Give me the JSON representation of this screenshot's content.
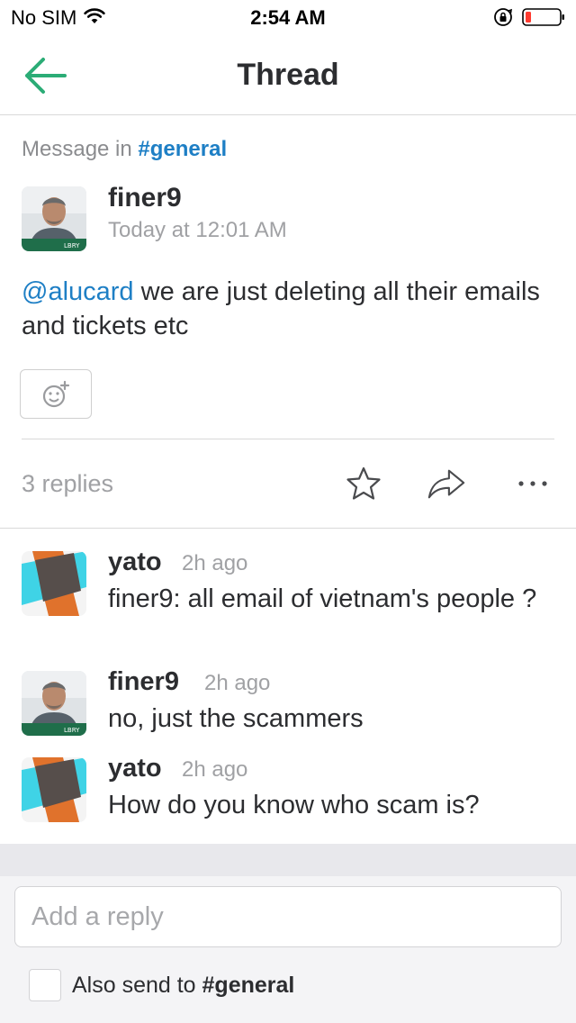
{
  "status_bar": {
    "carrier": "No SIM",
    "time": "2:54 AM"
  },
  "nav": {
    "title": "Thread",
    "back_icon": "arrow-left-icon",
    "accent": "#2bac76"
  },
  "parent": {
    "context_prefix": "Message in",
    "channel": "#general",
    "author": "finer9",
    "timestamp": "Today at 12:01 AM",
    "mention": "@alucard",
    "text": " we are just deleting all their emails and tickets etc",
    "reaction_icon": "add-reaction-icon",
    "replies_count": "3 replies",
    "actions": [
      "star-icon",
      "share-icon",
      "more-icon"
    ]
  },
  "replies": [
    {
      "author": "yato",
      "time": "2h ago",
      "text": "finer9: all email of vietnam's people ?",
      "avatar": "yato"
    },
    {
      "author": "finer9",
      "time": "2h ago",
      "text": "no, just the scammers",
      "avatar": "finer9"
    },
    {
      "author": "yato",
      "time": "2h ago",
      "text": "How do you know who scam is?",
      "avatar": "yato"
    }
  ],
  "composer": {
    "placeholder": "Add a reply",
    "also_send_prefix": "Also send to ",
    "also_send_channel": "#general"
  },
  "colors": {
    "link": "#1e7fc5",
    "muted": "#a0a1a4",
    "battery_low": "#ff3b30"
  }
}
